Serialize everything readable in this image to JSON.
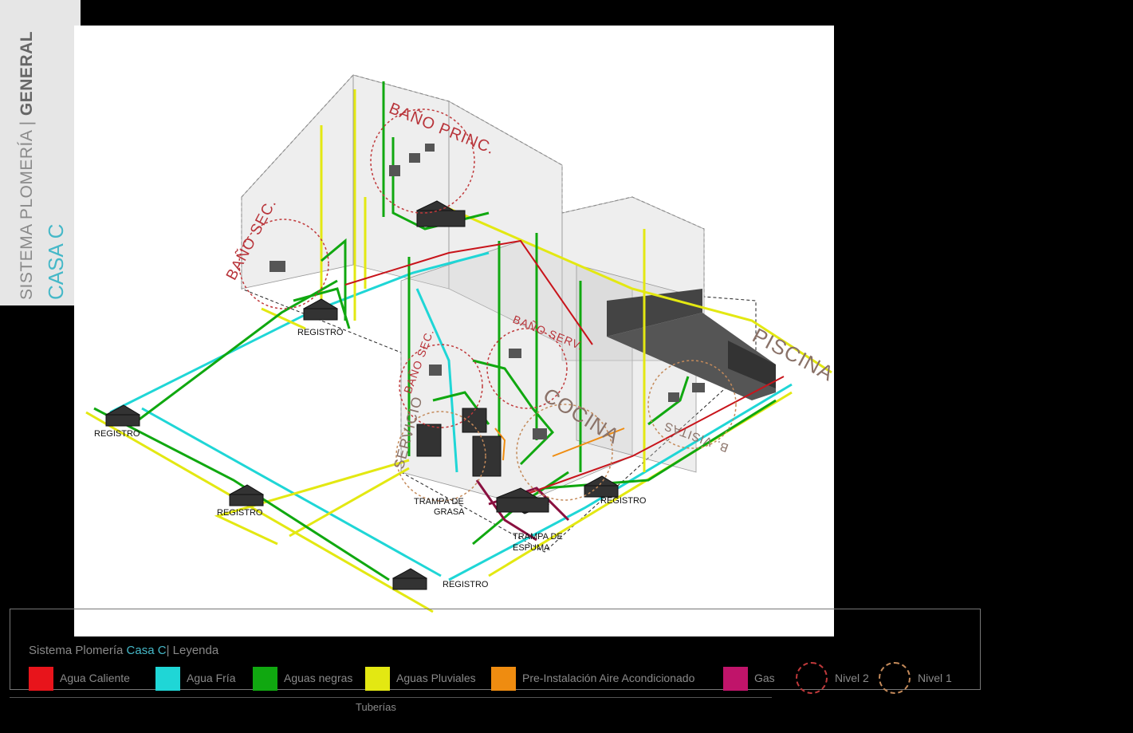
{
  "sidebar": {
    "title_light": "SISTEMA PLOMERÍA",
    "separator": "|",
    "title_bold": "GENERAL",
    "subtitle": "CASA C"
  },
  "zones": {
    "bano_princ": "BAÑO PRINC.",
    "bano_sec_top": "BAÑO SEC.",
    "bano_sec_mid": "BAÑO SEC.",
    "bano_serv": "BAÑO SERV.",
    "cocina": "COCINA",
    "servicio": "SERVICIO",
    "piscina": "PISCINA",
    "b_visitas": "B. VISITAS"
  },
  "labels": {
    "registro_1": "REGISTRO",
    "registro_2": "REGISTRO",
    "registro_3": "REGISTRO",
    "registro_4": "REGISTRO",
    "registro_5": "REGISTRO",
    "trampa_grasa_1": "TRAMPA DE",
    "trampa_grasa_2": "GRASA",
    "trampa_espuma_1": "TRAMPA DE",
    "trampa_espuma_2": "ESPUMA"
  },
  "legend": {
    "title_prefix": "Sistema Plomería",
    "title_accent": "Casa C",
    "title_suffix": "| Leyenda",
    "items": [
      {
        "label": "Agua Caliente",
        "color": "#e8141b"
      },
      {
        "label": "Agua Fría",
        "color": "#1fd6d6"
      },
      {
        "label": "Aguas negras",
        "color": "#10a810"
      },
      {
        "label": "Aguas Pluviales",
        "color": "#e3e812"
      },
      {
        "label": "Pre-Instalación Aire Acondicionado",
        "color": "#ef8c10"
      },
      {
        "label": "Gas",
        "color": "#c0146a"
      }
    ],
    "levels": [
      {
        "label": "Nivel 2",
        "color": "#c0393b"
      },
      {
        "label": "Nivel 1",
        "color": "#c48a5a"
      }
    ],
    "footer": "Tuberías"
  },
  "colors": {
    "accent": "#45b8c8",
    "zone_level2": "#b8343a",
    "zone_level1": "#8a7268"
  }
}
